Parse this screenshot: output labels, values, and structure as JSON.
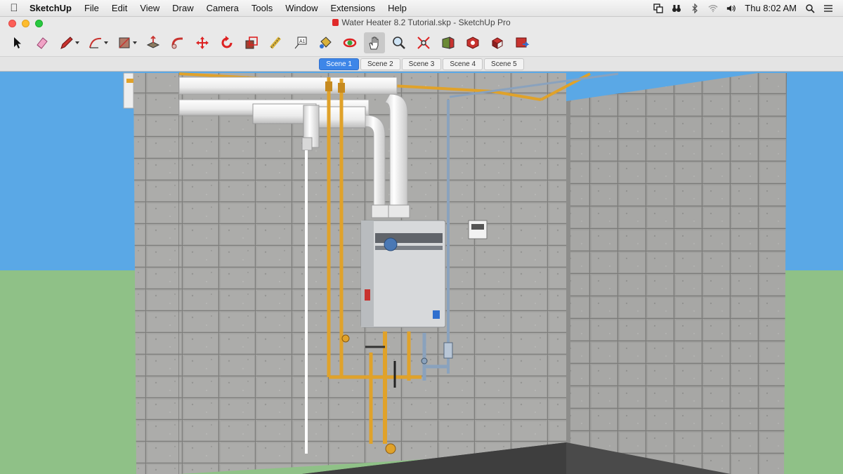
{
  "menubar": {
    "apple_icon": "apple-icon",
    "app_name": "SketchUp",
    "items": [
      "File",
      "Edit",
      "View",
      "Draw",
      "Camera",
      "Tools",
      "Window",
      "Extensions",
      "Help"
    ],
    "clock": "Thu 8:02 AM"
  },
  "window": {
    "title": "Water Heater 8.2 Tutorial.skp - SketchUp Pro"
  },
  "toolbar": {
    "tools": [
      "select-tool",
      "eraser-tool",
      "pencil-tool",
      "arc-tool",
      "rectangle-tool",
      "push-pull-tool",
      "follow-me-tool",
      "move-tool",
      "rotate-tool",
      "scale-tool",
      "tape-measure-tool",
      "text-tool",
      "paint-bucket-tool",
      "orbit-tool",
      "pan-tool",
      "zoom-tool",
      "zoom-extents-tool",
      "3d-warehouse-tool",
      "extension-warehouse-tool",
      "send-to-layout-tool",
      "extension-manager-tool"
    ],
    "active_tool": "pan-tool"
  },
  "scenes": {
    "tabs": [
      "Scene 1",
      "Scene 2",
      "Scene 3",
      "Scene 4",
      "Scene 5"
    ],
    "active_index": 0
  },
  "colors": {
    "sky": "#5aa8e6",
    "ground": "#8fc187",
    "wall": "#a5a5a3",
    "pipe_gas": "#e0a22a",
    "pipe_vent": "#f2f2f2",
    "pipe_water": "#8aa2bd",
    "scene_active": "#3d86e8"
  }
}
